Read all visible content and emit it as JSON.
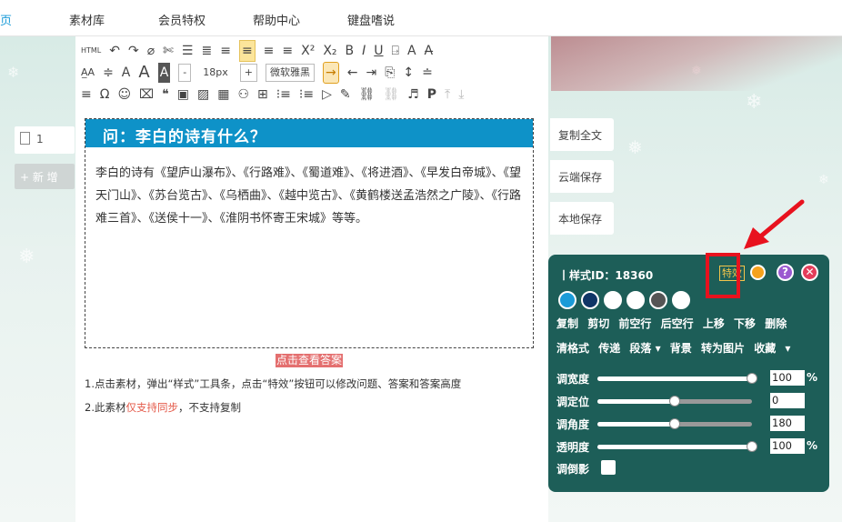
{
  "topnav": {
    "items": [
      "页",
      "素材库",
      "会员特权",
      "帮助中心",
      "键盘嗜说"
    ]
  },
  "left_panel": {
    "page_number": "1",
    "add_label": "+ 新 增"
  },
  "toolbar": {
    "row1": [
      "HTML",
      "↶",
      "↷",
      "⌀",
      "✄",
      "☰",
      "≣",
      "≡",
      "≡",
      "≡",
      "≡",
      "X²",
      "X₂",
      "B",
      "I",
      "U",
      "⍈",
      "A",
      "A̶"
    ],
    "row2": [
      "A̲A",
      "≑",
      "A",
      "A",
      "A",
      "-",
      "18px",
      "+",
      "微软雅黑",
      "→",
      "←",
      "⇥",
      "⎘",
      "↕",
      "≐"
    ],
    "row3": [
      "≡",
      "Ω",
      "☺",
      "⌧",
      "❝",
      "▣",
      "▨",
      "▦",
      "⚇",
      "⊞",
      "⁝≡",
      "⁝≡",
      "▷",
      "✎",
      "⛓",
      "⛓",
      "♬",
      "P",
      "⤒",
      "⤓"
    ]
  },
  "card": {
    "question": "问：李白的诗有什么？",
    "answer": "李白的诗有《望庐山瀑布》、《行路难》、《蜀道难》、《将进酒》、《早发白帝城》、《望天门山》、《苏台览古》、《乌栖曲》、《越中览古》、《黄鹤楼送孟浩然之广陵》、《行路难三首》、《送侯十一》、《淮阴书怀寄王宋城》等等。"
  },
  "reveal_label": "点击查看答案",
  "notes": {
    "line1": "1.点击素材，弹出“样式”工具条，点击“特效”按钮可以修改问题、答案和答案高度",
    "line2_a": "2.此素材",
    "line2_red": "仅支持同步",
    "line2_b": "，不支持复制"
  },
  "side_buttons": [
    "复制全文",
    "云端保存",
    "本地保存"
  ],
  "popup": {
    "style_id": "丨样式ID：18360",
    "effects_label": "特效",
    "help_label": "?",
    "close_label": "✕",
    "swatch_colors": [
      "#1a9bd8",
      "#0f3566",
      "#ffffff",
      "#ffffff",
      "#555555",
      "#ffffff"
    ],
    "actions_row1": [
      "复制",
      "剪切",
      "前空行",
      "后空行",
      "上移",
      "下移",
      "删除"
    ],
    "actions_row2": [
      "清格式",
      "传递",
      "段落 ▾",
      "背景",
      "转为图片",
      "收藏",
      "▾"
    ],
    "sliders": [
      {
        "label": "调宽度",
        "value": "100",
        "unit": "%",
        "fraction": 1.0
      },
      {
        "label": "调定位",
        "value": "0",
        "unit": "",
        "fraction": 0.5
      },
      {
        "label": "调角度",
        "value": "180",
        "unit": "",
        "fraction": 0.5
      },
      {
        "label": "透明度",
        "value": "100",
        "unit": "%",
        "fraction": 1.0
      }
    ],
    "shadow_label": "调倒影"
  },
  "colors": {
    "accent": "#0e92c8",
    "popup_bg": "#1d5e58",
    "highlight": "#e8121e"
  }
}
